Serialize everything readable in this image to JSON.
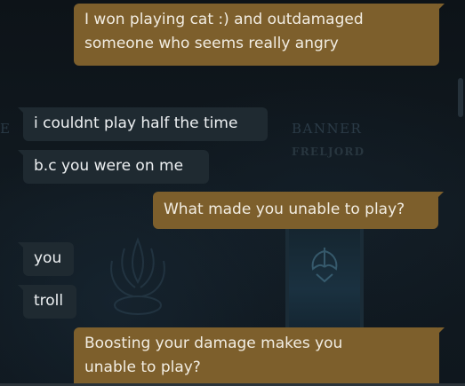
{
  "background": {
    "left_edge_letter": "E",
    "banner_title": "BANNER",
    "banner_subtitle": "FRELJORD"
  },
  "colors": {
    "outgoing_bubble": "#7d5f2c",
    "incoming_bubble": "#1f2a31",
    "chat_background": "#0e1419",
    "message_text": "#f2ede2"
  },
  "messages": [
    {
      "side": "outgoing",
      "lines": [
        "I won playing cat :) and outdamaged",
        "someone who seems really angry"
      ]
    },
    {
      "side": "incoming",
      "lines": [
        "i couldnt play half the time"
      ]
    },
    {
      "side": "incoming",
      "lines": [
        "b.c you were on me"
      ]
    },
    {
      "side": "outgoing",
      "lines": [
        "What made you unable to play?"
      ]
    },
    {
      "side": "incoming",
      "lines": [
        "you"
      ]
    },
    {
      "side": "incoming",
      "lines": [
        "troll"
      ]
    },
    {
      "side": "outgoing",
      "lines": [
        "Boosting your damage makes you",
        "unable to play?"
      ]
    }
  ]
}
